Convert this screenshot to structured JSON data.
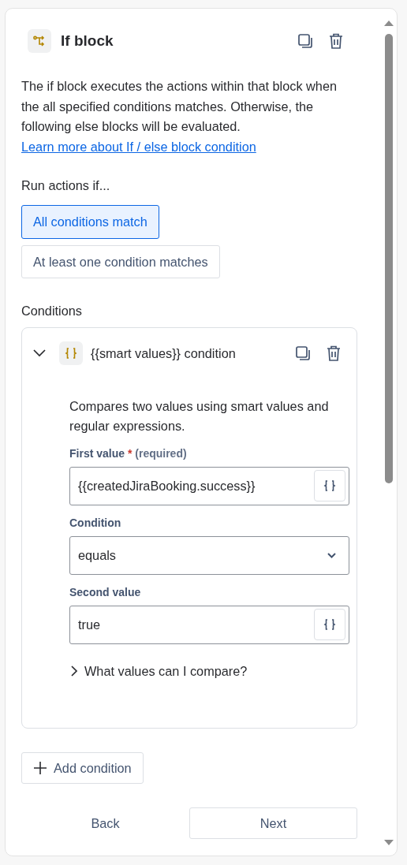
{
  "header": {
    "title": "If block"
  },
  "description": {
    "text": "The if block executes the actions within that block when the all specified conditions matches. Otherwise, the following else blocks will be evaluated.",
    "link": "Learn more about If / else block condition"
  },
  "run_actions": {
    "label": "Run actions if...",
    "options": [
      {
        "label": "All conditions match",
        "selected": true
      },
      {
        "label": "At least one condition matches",
        "selected": false
      }
    ]
  },
  "conditions": {
    "label": "Conditions",
    "items": [
      {
        "title": "{{smart values}} condition",
        "expanded": true,
        "description": "Compares two values using smart values and regular expressions.",
        "fields": [
          {
            "kind": "smart",
            "label": "First value",
            "required_mark": "*",
            "required_text": "(required)",
            "value": "{{createdJiraBooking.success}}"
          },
          {
            "kind": "select",
            "label": "Condition",
            "value": "equals"
          },
          {
            "kind": "smart",
            "label": "Second value",
            "value": "true"
          }
        ],
        "help": {
          "label": "What values can I compare?",
          "expanded": false
        }
      }
    ]
  },
  "add_button": "Add condition",
  "footer": {
    "back": "Back",
    "next": "Next"
  }
}
